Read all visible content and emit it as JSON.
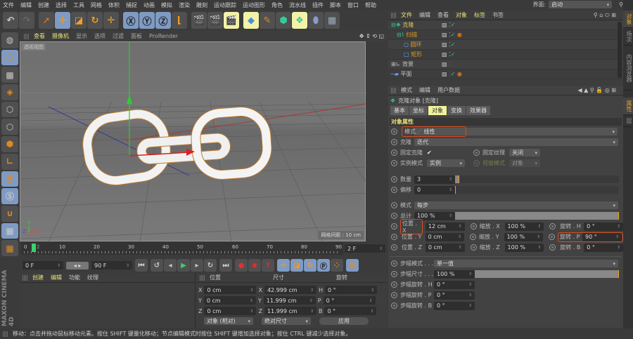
{
  "menu": [
    "文件",
    "编辑",
    "创建",
    "选择",
    "工具",
    "网格",
    "体积",
    "捕捉",
    "动画",
    "模拟",
    "渲染",
    "雕刻",
    "运动跟踪",
    "运动图形",
    "角色",
    "流水线",
    "插件",
    "脚本",
    "窗口",
    "帮助"
  ],
  "layout": {
    "label": "界面:",
    "value": "启动"
  },
  "viewport": {
    "menu": [
      "查看",
      "摄像机",
      "显示",
      "选项",
      "过滤",
      "面板",
      "ProRender"
    ],
    "view_label": "透视视图",
    "grid_spacing": "网格间距 : 10 cm",
    "axis": {
      "x": "X",
      "y": "Y",
      "z": "Z"
    }
  },
  "timeline": {
    "ticks": [
      "0",
      "10",
      "20",
      "30",
      "40",
      "50",
      "60",
      "70",
      "80",
      "90"
    ],
    "current_marker": "2",
    "current_frame": "2 F",
    "start": "0 F",
    "end": "90 F",
    "current_frame_value": 2,
    "max_frame": 90
  },
  "material": {
    "menu": [
      "创建",
      "编辑",
      "功能",
      "纹理"
    ]
  },
  "coords": {
    "headers": [
      "位置",
      "尺寸",
      "旋转"
    ],
    "rows": [
      {
        "a": "X",
        "pos": "0 cm",
        "b": "X",
        "size": "42.999 cm",
        "c": "H",
        "rot": "0 °"
      },
      {
        "a": "Y",
        "pos": "0 cm",
        "b": "Y",
        "size": "11.999 cm",
        "c": "P",
        "rot": "0 °"
      },
      {
        "a": "Z",
        "pos": "0 cm",
        "b": "Z",
        "size": "11.999 cm",
        "c": "B",
        "rot": "0 °"
      }
    ],
    "mode": "对象 (相对)",
    "size_mode": "绝对尺寸",
    "apply": "应用"
  },
  "objects": {
    "menu": [
      "文件",
      "编辑",
      "查看",
      "对象",
      "标签",
      "书签"
    ],
    "items": [
      {
        "name": "克隆",
        "level": 0,
        "color": "#e8c25a"
      },
      {
        "name": "扫描",
        "level": 1,
        "color": "#e09a2a"
      },
      {
        "name": "圆环",
        "level": 2,
        "color": "#e09a2a"
      },
      {
        "name": "矩形",
        "level": 2,
        "color": "#e09a2a"
      },
      {
        "name": "背景",
        "level": 0,
        "color": "#c8c8c8"
      },
      {
        "name": "平面",
        "level": 0,
        "color": "#c8c8c8"
      }
    ]
  },
  "attributes": {
    "menu": [
      "模式",
      "编辑",
      "用户数据"
    ],
    "title": "克隆对象 [克隆]",
    "tabs": [
      "基本",
      "坐标",
      "对象",
      "变换",
      "效果器"
    ],
    "active_tab": "对象",
    "section": "对象属性",
    "mode_label": "模式",
    "mode_value": "线性",
    "clone_label": "克隆",
    "clone_value": "迭代",
    "fix_clone_label": "固定克隆",
    "fix_clone_checked": "✔",
    "fix_tex_label": "固定纹理",
    "fix_tex_value": "关闭",
    "instance_label": "实例模式",
    "instance_value": "实例",
    "viewport_mode_label": "视窗模式",
    "viewport_mode_value": "对象",
    "count_label": "数量",
    "count_value": "3",
    "offset_label": "偏移",
    "offset_value": "0",
    "mode2_label": "模式",
    "mode2_value": "每步",
    "total_label": "总计",
    "total_value": "100 %",
    "grid": [
      [
        "位置 . X",
        "12 cm",
        "缩放 . X",
        "100 %",
        "旋转 . H",
        "0 °"
      ],
      [
        "位置 . Y",
        "0 cm",
        "缩放 . Y",
        "100 %",
        "旋转 . P",
        "90 °"
      ],
      [
        "位置 . Z",
        "0 cm",
        "缩放 . Z",
        "100 %",
        "旋转 . B",
        "0 °"
      ]
    ],
    "step_mode_label": "步幅模式 . . .",
    "step_mode_value": "单一值",
    "step_size_label": "步幅尺寸 . . .",
    "step_size_value": "100 %",
    "step_rot": [
      [
        "步幅旋转 . H",
        "0 °"
      ],
      [
        "步幅旋转 . P",
        "0 °"
      ],
      [
        "步幅旋转 . B",
        "0 °"
      ]
    ]
  },
  "right_tabs": [
    "对象",
    "场次",
    "内容浏览器",
    "属性",
    "层"
  ],
  "status": "移动：点击并拖动鼠标移动元素。按住 SHIFT 键量化移动；节点编辑模式时按住 SHIFT 键增加选择对象；按住 CTRL 键减少选择对象。",
  "logo": "MAXON CINEMA 4D",
  "colors": {
    "accent": "#e8e07a",
    "highlight": "#e24a1c",
    "selection": "#7f9bc4"
  }
}
